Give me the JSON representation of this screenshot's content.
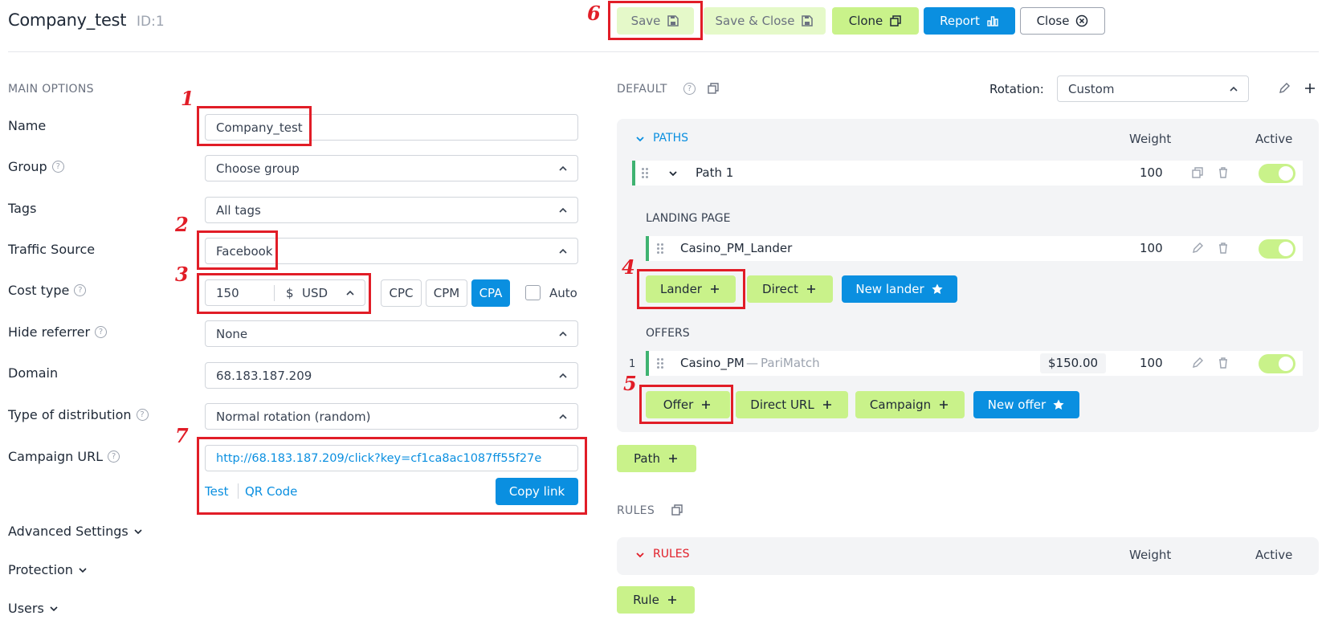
{
  "header": {
    "title": "Company_test",
    "id_label": "ID:1",
    "buttons": {
      "save": "Save",
      "save_close": "Save & Close",
      "clone": "Clone",
      "report": "Report",
      "close": "Close"
    }
  },
  "main_options": {
    "section_title": "MAIN OPTIONS",
    "name": {
      "label": "Name",
      "value": "Company_test"
    },
    "group": {
      "label": "Group",
      "value": "Choose group"
    },
    "tags": {
      "label": "Tags",
      "value": "All tags"
    },
    "traffic_source": {
      "label": "Traffic Source",
      "value": "Facebook"
    },
    "cost_type": {
      "label": "Cost type",
      "amount": "150",
      "currency_symbol": "$",
      "currency": "USD",
      "options": [
        "CPC",
        "CPM",
        "CPA"
      ],
      "selected": "CPA",
      "auto_label": "Auto"
    },
    "hide_referrer": {
      "label": "Hide referrer",
      "value": "None"
    },
    "domain": {
      "label": "Domain",
      "value": "68.183.187.209"
    },
    "distribution": {
      "label": "Type of distribution",
      "value": "Normal rotation (random)"
    },
    "campaign_url": {
      "label": "Campaign URL",
      "value": "http://68.183.187.209/click?key=cf1ca8ac1087ff55f27e",
      "test": "Test",
      "qr": "QR Code",
      "copy": "Copy link"
    },
    "collapsibles": [
      "Advanced Settings",
      "Protection",
      "Users"
    ]
  },
  "default_section": {
    "title": "DEFAULT",
    "rotation_label": "Rotation:",
    "rotation_value": "Custom",
    "paths_title": "PATHS",
    "weight_col": "Weight",
    "active_col": "Active",
    "path": {
      "name": "Path 1",
      "weight": "100"
    },
    "landing_title": "LANDING PAGE",
    "lander": {
      "name": "Casino_PM_Lander",
      "weight": "100"
    },
    "lander_buttons": {
      "lander": "Lander",
      "direct": "Direct",
      "new": "New lander"
    },
    "offers_title": "OFFERS",
    "offer": {
      "index": "1",
      "name": "Casino_PM",
      "separator": "—",
      "network": "PariMatch",
      "payout": "$150.00",
      "weight": "100"
    },
    "offer_buttons": {
      "offer": "Offer",
      "direct_url": "Direct URL",
      "campaign": "Campaign",
      "new": "New offer"
    },
    "path_button": "Path"
  },
  "rules_section": {
    "title": "RULES",
    "rules_title": "RULES",
    "weight_col": "Weight",
    "active_col": "Active",
    "rule_button": "Rule"
  },
  "annotations": [
    "1",
    "2",
    "3",
    "4",
    "5",
    "6",
    "7"
  ],
  "colors": {
    "lime": "#c9f28a",
    "blue": "#0a8fe0",
    "red": "#e11d27",
    "green_bar": "#3fb371"
  }
}
